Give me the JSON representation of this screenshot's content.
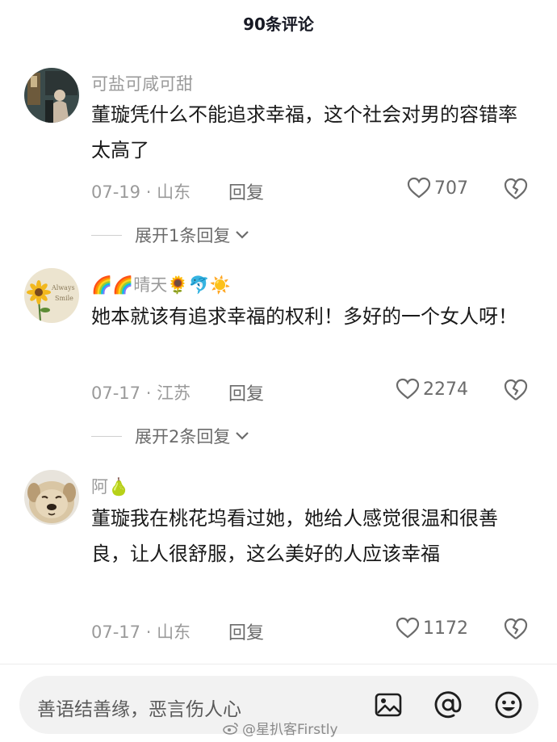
{
  "header": {
    "title": "90条评论"
  },
  "comments": [
    {
      "username": "可盐可咸可甜",
      "text": "董璇凭什么不能追求幸福，这个社会对男的容错率太高了",
      "date": "07-19",
      "location": "山东",
      "reply_label": "回复",
      "likes": "707",
      "expand_label": "展开1条回复",
      "avatar_icon": "person-photo-avatar"
    },
    {
      "username": "🌈🌈晴天🌻🐬☀️",
      "text": "她本就该有追求幸福的权利！多好的一个女人呀！",
      "date": "07-17",
      "location": "江苏",
      "reply_label": "回复",
      "likes": "2274",
      "expand_label": "展开2条回复",
      "avatar_icon": "sunflower-avatar"
    },
    {
      "username": "阿🍐",
      "text": "董璇我在桃花坞看过她，她给人感觉很温和很善良，让人很舒服，这么美好的人应该幸福",
      "date": "07-17",
      "location": "山东",
      "reply_label": "回复",
      "likes": "1172",
      "avatar_icon": "dog-avatar"
    }
  ],
  "input_bar": {
    "placeholder": "善语结善缘，恶言伤人心",
    "icons": [
      "image-icon",
      "at-icon",
      "emoji-icon"
    ]
  },
  "watermark": "@星扒客Firstly",
  "colors": {
    "text_primary": "#1a1a1a",
    "text_secondary": "#9a9a9a",
    "input_bg": "#f2f2f2"
  }
}
